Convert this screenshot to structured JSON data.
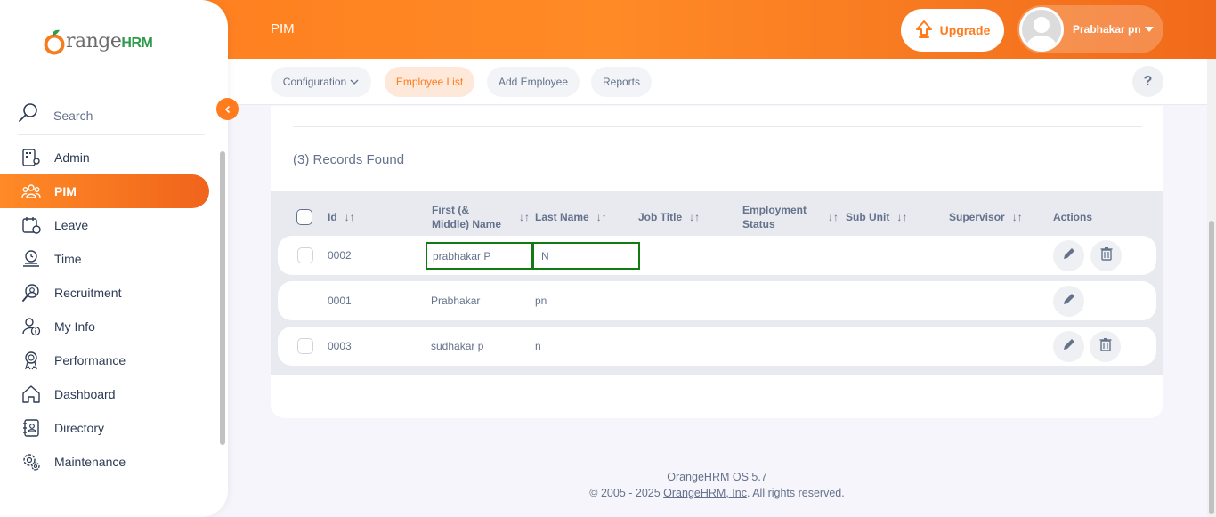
{
  "header": {
    "module_title": "PIM",
    "upgrade_label": "Upgrade",
    "user_name": "Prabhakar pn"
  },
  "brand": {
    "part1": "range",
    "part2": "HRM"
  },
  "subnav": {
    "items": [
      {
        "label": "Configuration"
      },
      {
        "label": "Employee List"
      },
      {
        "label": "Add Employee"
      },
      {
        "label": "Reports"
      }
    ],
    "help_label": "?"
  },
  "sidebar": {
    "search_label": "Search",
    "items": [
      {
        "label": "Admin",
        "icon": "admin-icon"
      },
      {
        "label": "PIM",
        "icon": "pim-icon"
      },
      {
        "label": "Leave",
        "icon": "leave-icon"
      },
      {
        "label": "Time",
        "icon": "time-icon"
      },
      {
        "label": "Recruitment",
        "icon": "recruitment-icon"
      },
      {
        "label": "My Info",
        "icon": "my-info-icon"
      },
      {
        "label": "Performance",
        "icon": "performance-icon"
      },
      {
        "label": "Dashboard",
        "icon": "dashboard-icon"
      },
      {
        "label": "Directory",
        "icon": "directory-icon"
      },
      {
        "label": "Maintenance",
        "icon": "maintenance-icon"
      }
    ]
  },
  "records_label": "(3) Records Found",
  "table": {
    "headers": {
      "id": "Id",
      "first_name_1": "First (&",
      "first_name_2": "Middle) Name",
      "last_name": "Last Name",
      "job_title": "Job Title",
      "employment_status_1": "Employment",
      "employment_status_2": "Status",
      "sub_unit": "Sub Unit",
      "supervisor": "Supervisor",
      "actions": "Actions"
    },
    "rows": [
      {
        "id": "0002",
        "first": "prabhakar P",
        "last": "N"
      },
      {
        "id": "0001",
        "first": "Prabhakar",
        "last": "pn"
      },
      {
        "id": "0003",
        "first": "sudhakar p",
        "last": "n"
      }
    ]
  },
  "footer": {
    "version": "OrangeHRM OS 5.7",
    "copyright_prefix": "© 2005 - 2025 ",
    "company_link": "OrangeHRM, Inc",
    "copyright_suffix": ". All rights reserved."
  },
  "colors": {
    "accent": "#ff7b1d",
    "highlight_border": "#117a11"
  }
}
